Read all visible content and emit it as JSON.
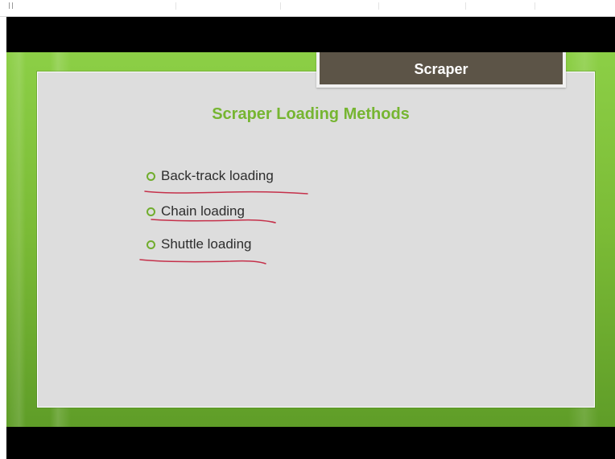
{
  "slide": {
    "tab_title": "Scraper",
    "heading": "Scraper Loading Methods",
    "items": [
      {
        "label": "Back-track loading"
      },
      {
        "label": "Chain loading"
      },
      {
        "label": "Shuttle loading"
      }
    ]
  },
  "colors": {
    "slide_green": "#7bbb36",
    "heading_green": "#76b531",
    "tab_brown": "#5c5447",
    "panel_gray": "#dddddd",
    "annotation_red": "#c5304a",
    "black_bars": "#000000"
  },
  "icons": {
    "bullet": "green-ring-bullet-icon"
  }
}
